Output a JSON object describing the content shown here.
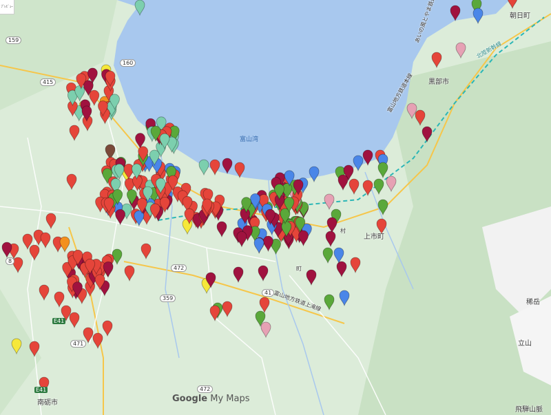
{
  "map": {
    "corner_button_label": "ﾌﾟﾚﾋﾞｭｰ",
    "branding": {
      "prefix": "Google",
      "suffix": " My Maps"
    },
    "water_label": "富山湾",
    "place_labels": [
      {
        "id": "asahi",
        "text": "朝日町"
      },
      {
        "id": "kurobe",
        "text": "黒部市"
      },
      {
        "id": "kamiichi",
        "text": "上市町"
      },
      {
        "id": "tateyama",
        "text": "立山"
      },
      {
        "id": "kabutoyama",
        "text": "稀岳"
      },
      {
        "id": "hida",
        "text": "飛騨山脈"
      },
      {
        "id": "nanto",
        "text": "南砺市"
      },
      {
        "id": "tetsudo",
        "text": "あいの風とやま鉄道"
      },
      {
        "id": "shinkansen",
        "text": "北陸新幹線"
      },
      {
        "id": "chitetsu",
        "text": "富山地方鉄道本線"
      },
      {
        "id": "kamitaki",
        "text": "富山地方鉄道上滝線"
      },
      {
        "id": "village",
        "text": "村"
      },
      {
        "id": "station_mark",
        "text": "町"
      }
    ],
    "route_shields": [
      "159",
      "160",
      "415",
      "472",
      "471",
      "359",
      "41",
      "472",
      "E41",
      "8",
      "E41"
    ],
    "markers": {
      "colors": {
        "red": "#e5453a",
        "crimson": "#a0123f",
        "green": "#5aa83a",
        "blue": "#4a86e8",
        "teal": "#7ccfae",
        "pink": "#e6a1b4",
        "yellow": "#f6e83a",
        "orange": "#f3901e",
        "brown": "#7a4a3a"
      }
    }
  }
}
